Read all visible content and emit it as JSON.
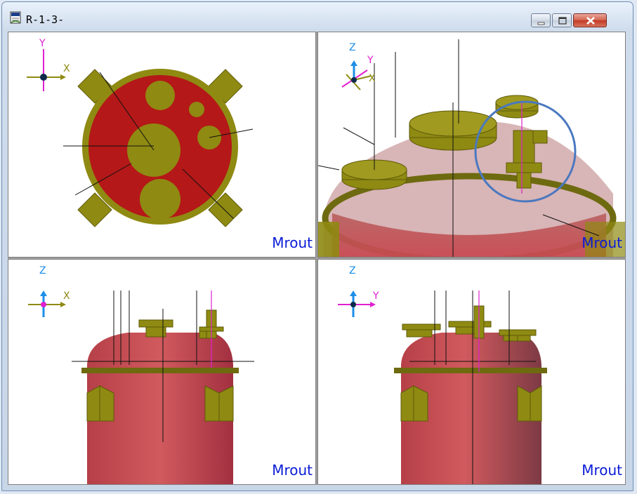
{
  "window": {
    "title": "R-1-3-",
    "icon": "document-icon"
  },
  "controls": {
    "minimize": "minimize-icon",
    "maximize": "maximize-icon",
    "close": "close-icon"
  },
  "viewports": [
    {
      "name": "top-view",
      "label": "Mrout",
      "axes": [
        "Y",
        "X"
      ]
    },
    {
      "name": "iso-view",
      "label": "Mrout",
      "axes": [
        "Z",
        "Y",
        "X"
      ]
    },
    {
      "name": "front-view",
      "label": "Mrout",
      "axes": [
        "Z",
        "X"
      ]
    },
    {
      "name": "side-view",
      "label": "Mrout",
      "axes": [
        "Z",
        "Y"
      ]
    }
  ],
  "colors": {
    "vessel_red": "#b41818",
    "nozzle_olive": "#8f8a12",
    "highlight_circle": "#4a78c0",
    "label_blue": "#0a1bd8"
  }
}
